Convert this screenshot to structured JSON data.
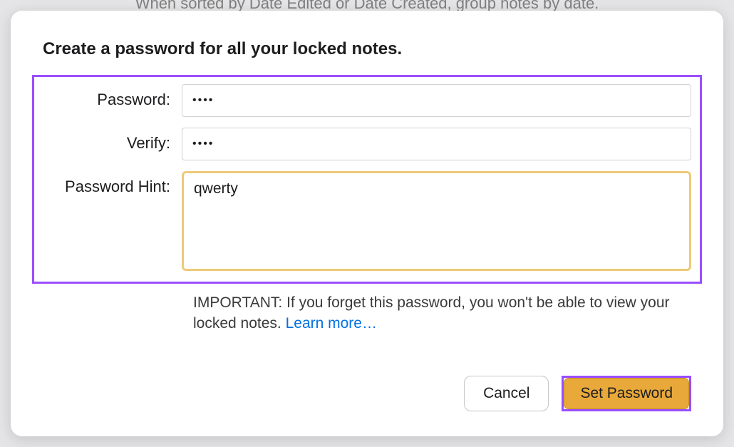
{
  "background_partial_text": "When sorted by Date Edited or Date Created, group notes by date.",
  "dialog": {
    "heading": "Create a password for all your locked notes.",
    "form": {
      "password": {
        "label": "Password:",
        "value": "••••"
      },
      "verify": {
        "label": "Verify:",
        "value": "••••"
      },
      "hint": {
        "label": "Password Hint:",
        "value": "qwerty"
      }
    },
    "important": {
      "prefix": "IMPORTANT: If you forget this password, you won't be able to view your locked notes. ",
      "learn_more": "Learn more…"
    },
    "buttons": {
      "cancel": "Cancel",
      "set_password": "Set Password"
    }
  }
}
